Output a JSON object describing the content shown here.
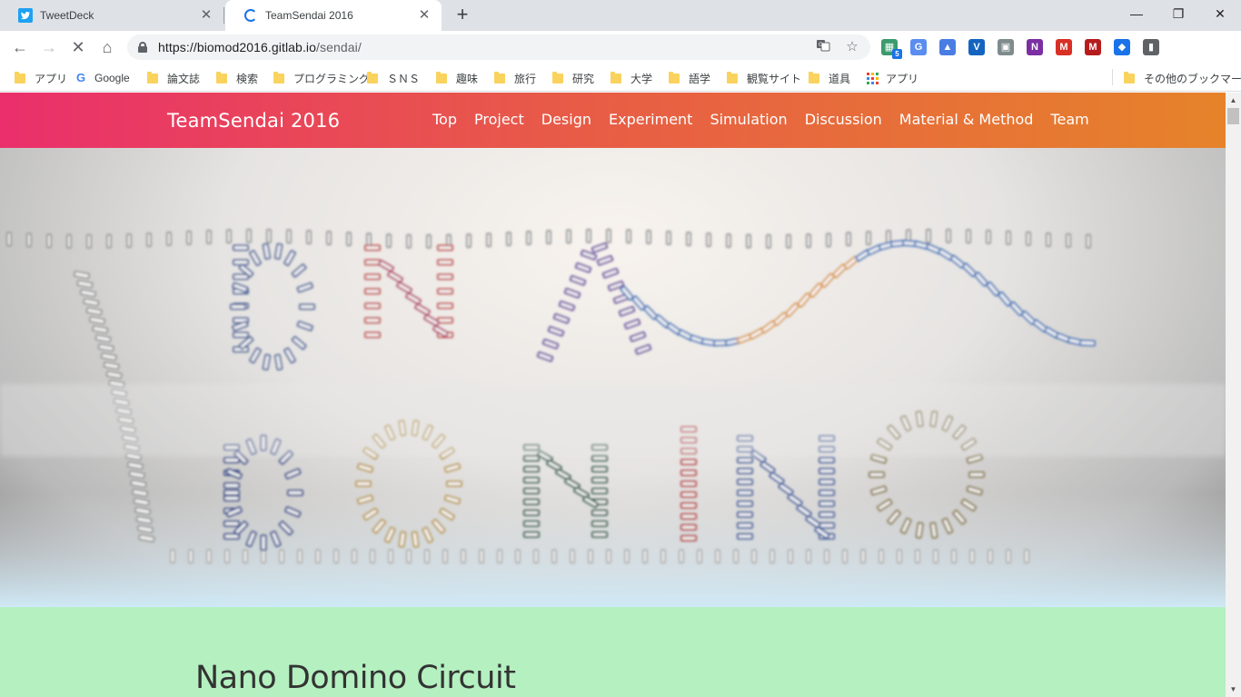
{
  "tabs": [
    {
      "title": "TweetDeck",
      "icon": "twitter-icon",
      "state": "inactive"
    },
    {
      "title": "TeamSendai 2016",
      "icon": "loading-spinner-icon",
      "state": "active"
    }
  ],
  "toolbar": {
    "url_host": "https://biomod2016.gitlab.io",
    "url_path": "/sendai/",
    "extension_badge": "5"
  },
  "bookmarks": [
    {
      "label": "アプリ",
      "icon": "folder-icon"
    },
    {
      "label": "Google",
      "icon": "google-icon"
    },
    {
      "label": "論文誌",
      "icon": "folder-icon"
    },
    {
      "label": "検索",
      "icon": "folder-icon"
    },
    {
      "label": "プログラミング",
      "icon": "folder-icon"
    },
    {
      "label": "ＳＮＳ",
      "icon": "folder-icon"
    },
    {
      "label": "趣味",
      "icon": "folder-icon"
    },
    {
      "label": "旅行",
      "icon": "folder-icon"
    },
    {
      "label": "研究",
      "icon": "folder-icon"
    },
    {
      "label": "大学",
      "icon": "folder-icon"
    },
    {
      "label": "語学",
      "icon": "folder-icon"
    },
    {
      "label": "観覧サイト",
      "icon": "folder-icon"
    },
    {
      "label": "道具",
      "icon": "folder-icon"
    },
    {
      "label": "アプリ",
      "icon": "apps-grid-icon"
    }
  ],
  "other_bookmarks": "その他のブックマーク",
  "site": {
    "brand": "TeamSendai 2016",
    "nav": [
      "Top",
      "Project",
      "Design",
      "Experiment",
      "Simulation",
      "Discussion",
      "Material & Method",
      "Team"
    ],
    "hero_alt": "DNA DOMINO",
    "section_title": "Nano Domino Circuit"
  },
  "colors": {
    "nav_gradient_start": "#ea2f6c",
    "nav_gradient_end": "#e6832a",
    "content_bg": "#b4f0c0"
  }
}
